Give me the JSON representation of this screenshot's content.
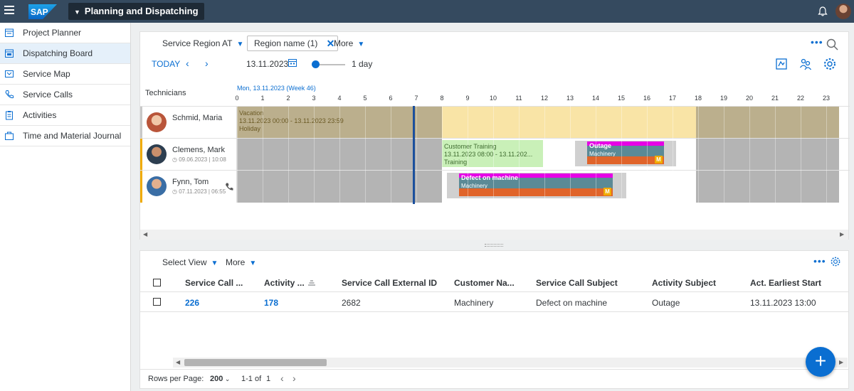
{
  "shell": {
    "logo": "SAP",
    "app_title": "Planning and Dispatching"
  },
  "sidenav": {
    "items": [
      {
        "label": "Project Planner",
        "icon": "project-planner-icon"
      },
      {
        "label": "Dispatching Board",
        "icon": "dispatching-board-icon",
        "active": true
      },
      {
        "label": "Service Map",
        "icon": "map-icon"
      },
      {
        "label": "Service Calls",
        "icon": "phone-icon"
      },
      {
        "label": "Activities",
        "icon": "clipboard-icon"
      },
      {
        "label": "Time and Material Journal",
        "icon": "journal-icon"
      }
    ]
  },
  "planner": {
    "filter_region": "Service Region AT",
    "filter_token": "Region name (1)",
    "more": "More",
    "today": "TODAY",
    "date": "13.11.2023",
    "range": "1 day",
    "technicians_header": "Technicians",
    "date_label": "Mon, 13.11.2023 (Week 46)",
    "hours": [
      "0",
      "1",
      "2",
      "3",
      "4",
      "5",
      "6",
      "7",
      "8",
      "9",
      "10",
      "11",
      "12",
      "13",
      "14",
      "15",
      "16",
      "17",
      "18",
      "19",
      "20",
      "21",
      "22",
      "23"
    ],
    "technicians": [
      {
        "name": "Schmid, Maria",
        "sub": ""
      },
      {
        "name": "Clemens, Mark",
        "sub": "◷ 09.06.2023 | 10:08"
      },
      {
        "name": "Fynn, Tom",
        "sub": "◷ 07.11.2023 | 06:55"
      }
    ],
    "events": {
      "vacation": {
        "title": "Vacation",
        "time": "13.11.2023 00:00 - 13.11.2023 23:59",
        "type": "Holiday"
      },
      "training": {
        "title": "Customer Training",
        "time": "13.11.2023 08:00 - 13.11.202...",
        "type": "Training"
      },
      "outage": {
        "title": "Outage",
        "customer": "Machinery",
        "badge": "M"
      },
      "defect": {
        "title": "Defect on machine",
        "customer": "Machinery",
        "badge": "M"
      }
    },
    "colors": {
      "accent": "#0a6ed1",
      "offhours": "#c0c0c0",
      "vacation": "#f9e4a6",
      "training": "#c9f0b8",
      "magenta": "#e600e6",
      "teal": "#5b8a96",
      "orange": "#e0642a"
    }
  },
  "table": {
    "select_view": "Select View",
    "more": "More",
    "columns": [
      "Service Call ...",
      "Activity ...",
      "Service Call External ID",
      "Customer Na...",
      "Service Call Subject",
      "Activity Subject",
      "Act. Earliest Start"
    ],
    "rows": [
      {
        "service_call": "226",
        "activity": "178",
        "external_id": "2682",
        "customer": "Machinery",
        "subject": "Defect on machine",
        "activity_subject": "Outage",
        "earliest_start": "13.11.2023 13:00"
      }
    ],
    "footer": {
      "rows_per_page_label": "Rows per Page:",
      "rows_per_page": "200",
      "range": "1-1 of",
      "total": "1"
    }
  }
}
